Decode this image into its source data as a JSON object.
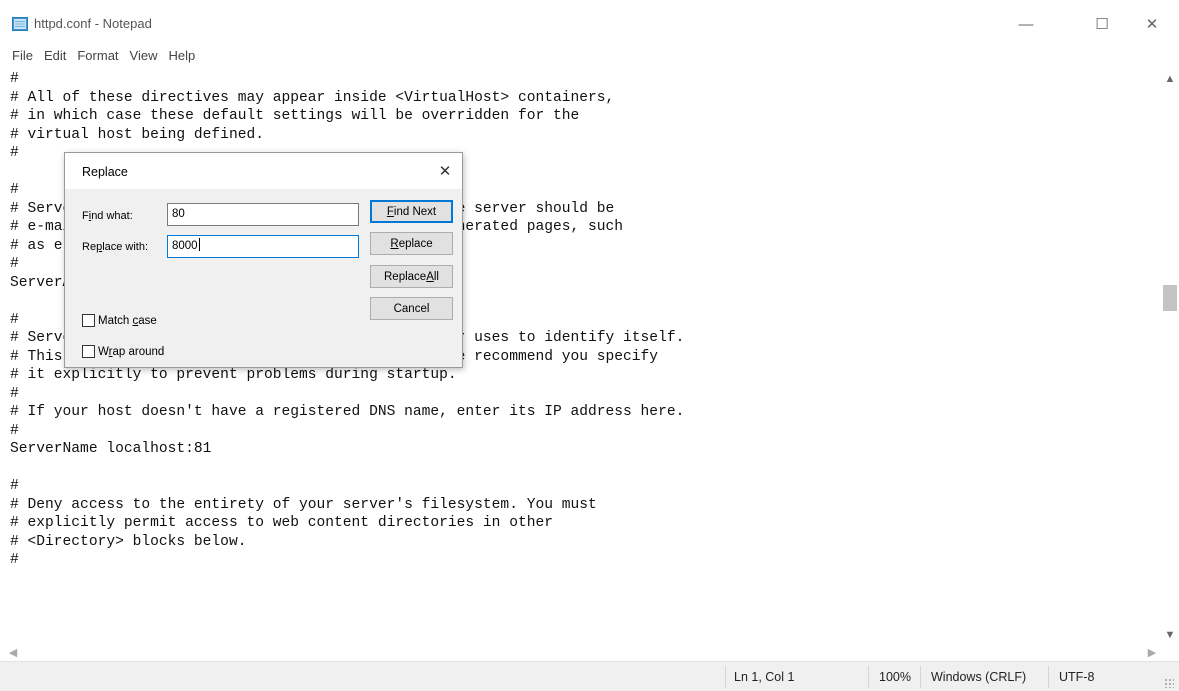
{
  "window": {
    "title": "httpd.conf - Notepad",
    "controls": {
      "minimize": "—",
      "maximize": "☐",
      "close": "✕"
    }
  },
  "menu": [
    "File",
    "Edit",
    "Format",
    "View",
    "Help"
  ],
  "editor": {
    "lines": [
      "#",
      "# All of these directives may appear inside <VirtualHost> containers,",
      "# in which case these default settings will be overridden for the",
      "# virtual host being defined.",
      "#",
      "",
      "#",
      "# ServerAdmin: Your address, where problems with the server should be",
      "# e-mailed.  This address appears on some server-generated pages, such",
      "# as error documents.  e.g. admin@your-domain.com",
      "#",
      "ServerAdmin postmaster@localhost",
      "",
      "#",
      "# ServerName gives the name and port that the server uses to identify itself.",
      "# This can often be determined automatically, but we recommend you specify",
      "# it explicitly to prevent problems during startup.",
      "#",
      "# If your host doesn't have a registered DNS name, enter its IP address here.",
      "#",
      "ServerName localhost:81",
      "",
      "#",
      "# Deny access to the entirety of your server's filesystem. You must",
      "# explicitly permit access to web content directories in other",
      "# <Directory> blocks below.",
      "#"
    ]
  },
  "replace_dialog": {
    "title": "Replace",
    "find_label": {
      "pre": "F",
      "key": "i",
      "post": "nd what:"
    },
    "find_value": "80",
    "replace_label": {
      "pre": "Re",
      "key": "p",
      "post": "lace with:"
    },
    "replace_value": "8000",
    "buttons": {
      "find_next": {
        "pre": "",
        "key": "F",
        "post": "ind Next"
      },
      "replace": {
        "pre": "",
        "key": "R",
        "post": "eplace"
      },
      "replace_all": {
        "pre": "Replace ",
        "key": "A",
        "post": "ll"
      },
      "cancel": "Cancel"
    },
    "match_case": {
      "pre": "Match ",
      "key": "c",
      "post": "ase",
      "checked": false
    },
    "wrap_around": {
      "pre": "W",
      "key": "r",
      "post": "ap around",
      "checked": false
    }
  },
  "status": {
    "position": "Ln 1, Col 1",
    "zoom": "100%",
    "line_ending": "Windows (CRLF)",
    "encoding": "UTF-8"
  },
  "icons": {
    "app": "notepad-icon",
    "scroll_up": "▲",
    "scroll_down": "▼",
    "scroll_left": "◀",
    "scroll_right": "▶"
  },
  "colors": {
    "accent": "#0078d7",
    "dialog_bg": "#f0f0f0",
    "status_bg": "#f0f0f0"
  }
}
